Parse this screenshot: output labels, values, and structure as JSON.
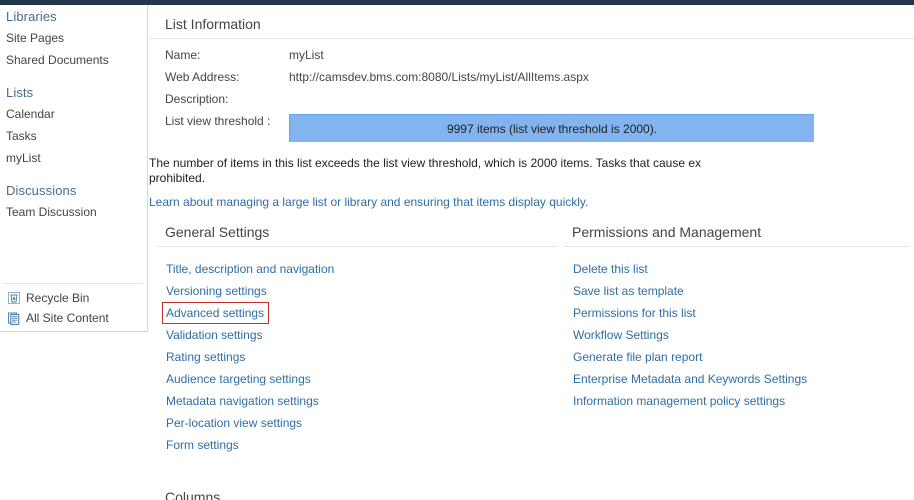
{
  "quick_launch": {
    "libraries": {
      "heading": "Libraries",
      "items": [
        {
          "label": "Site Pages"
        },
        {
          "label": "Shared Documents"
        }
      ]
    },
    "lists": {
      "heading": "Lists",
      "items": [
        {
          "label": "Calendar"
        },
        {
          "label": "Tasks"
        },
        {
          "label": "myList"
        }
      ]
    },
    "discussions": {
      "heading": "Discussions",
      "items": [
        {
          "label": "Team Discussion"
        }
      ]
    },
    "bottom": [
      {
        "label": "Recycle Bin",
        "icon": "recycle-bin-icon"
      },
      {
        "label": "All Site Content",
        "icon": "all-site-content-icon"
      }
    ]
  },
  "list_information": {
    "heading": "List Information",
    "fields": [
      {
        "label": "Name:",
        "value": "myList"
      },
      {
        "label": "Web Address:",
        "value": "http://camsdev.bms.com:8080/Lists/myList/AllItems.aspx"
      },
      {
        "label": "Description:",
        "value": ""
      },
      {
        "label": "List view threshold :",
        "value": ""
      }
    ],
    "threshold_banner": "9997 items (list view threshold is 2000).",
    "threshold_description_line1": "The number of items in this list exceeds the list view threshold, which is 2000 items. Tasks that cause ex",
    "threshold_description_line2": "prohibited.",
    "threshold_learn_link": "Learn about managing a large list or library and ensuring that items display quickly."
  },
  "general_settings": {
    "heading": "General Settings",
    "links": [
      {
        "label": "Title, description and navigation",
        "highlighted": false
      },
      {
        "label": "Versioning settings",
        "highlighted": false
      },
      {
        "label": "Advanced settings",
        "highlighted": true
      },
      {
        "label": "Validation settings",
        "highlighted": false
      },
      {
        "label": "Rating settings",
        "highlighted": false
      },
      {
        "label": "Audience targeting settings",
        "highlighted": false
      },
      {
        "label": "Metadata navigation settings",
        "highlighted": false
      },
      {
        "label": "Per-location view settings",
        "highlighted": false
      },
      {
        "label": "Form settings",
        "highlighted": false
      }
    ]
  },
  "permissions_and_management": {
    "heading": "Permissions and Management",
    "links": [
      {
        "label": "Delete this list"
      },
      {
        "label": "Save list as template"
      },
      {
        "label": "Permissions for this list"
      },
      {
        "label": "Workflow Settings"
      },
      {
        "label": "Generate file plan report"
      },
      {
        "label": "Enterprise Metadata and Keywords Settings"
      },
      {
        "label": "Information management policy settings"
      }
    ]
  },
  "columns_section": {
    "heading": "Columns"
  },
  "colors": {
    "top_bar": "#21374c",
    "link": "#2e6da6",
    "heading_blue": "#4a6c8e",
    "banner_blue": "#82b4f0",
    "highlight_box": "#c23030",
    "text": "#444444"
  }
}
